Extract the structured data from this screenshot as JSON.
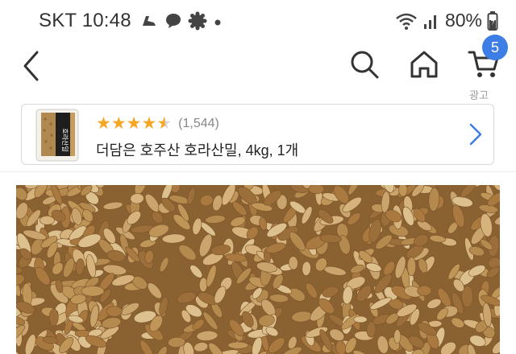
{
  "status_bar": {
    "carrier_time": "SKT 10:48",
    "battery_percent": "80%",
    "icons": [
      "shoe-icon",
      "chat-bubble-icon",
      "gear-badge-icon",
      "dot-icon",
      "wifi-icon",
      "signal-icon",
      "battery-charging-icon"
    ]
  },
  "nav": {
    "cart_count": "5",
    "ad_label": "광고",
    "icons": [
      "back-chevron-icon",
      "search-icon",
      "home-icon",
      "cart-icon"
    ]
  },
  "product": {
    "rating": 4.5,
    "rating_count": "(1,544)",
    "title": "더담은 호주산 호라산밀, 4kg, 1개",
    "thumbnail_label": "호라산밀"
  },
  "colors": {
    "accent_blue": "#3d7de6",
    "star": "#f5a623",
    "grain": "#b3884f"
  }
}
